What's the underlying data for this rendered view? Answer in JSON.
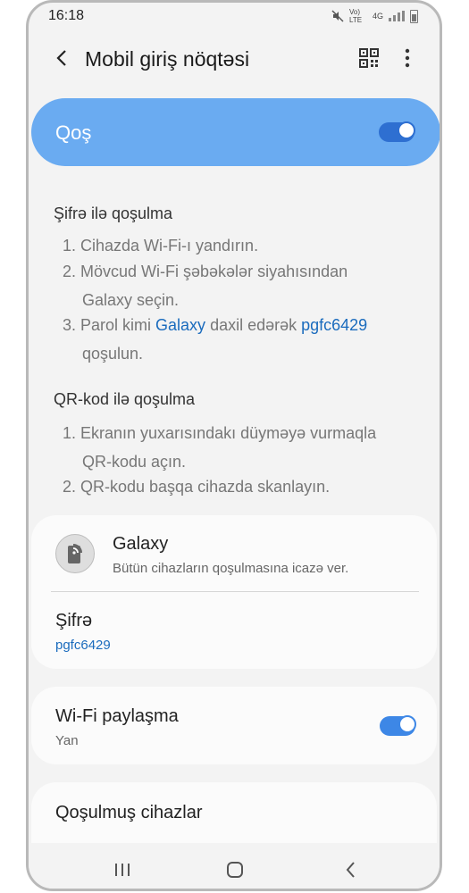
{
  "status": {
    "time": "16:18",
    "network_volte": "Vo) LTE",
    "network_4g": "4G"
  },
  "header": {
    "title": "Mobil giriş nöqtəsi",
    "back_icon": "back-arrow-icon",
    "qr_icon": "qr-code-icon",
    "more_icon": "more-vertical-icon"
  },
  "main_toggle": {
    "label": "Qoş",
    "on": true
  },
  "password_section": {
    "heading": "Şifrə ilə qoşulma",
    "step1": "1. Cihazda Wi-Fi-ı yandırın.",
    "step2_a": "2. Mövcud Wi-Fi şəbəkələr siyahısından",
    "step2_name": "Galaxy",
    "step2_b": " seçin.",
    "step3_a": "3. Parol kimi ",
    "step3_name": "Galaxy",
    "step3_b": " daxil edərək ",
    "step3_pass": "pgfc6429",
    "step3_c": "qoşulun."
  },
  "qr_section": {
    "heading": "QR-kod ilə qoşulma",
    "step1_a": "1. Ekranın yuxarısındakı düyməyə vurmaqla",
    "step1_b": "QR-kodu açın.",
    "step2": "2. QR-kodu başqa cihazda skanlayın."
  },
  "network": {
    "name": "Galaxy",
    "description": "Bütün cihazların qoşulmasına icazə ver.",
    "icon": "hotspot-icon"
  },
  "password": {
    "label": "Şifrə",
    "value": "pgfc6429"
  },
  "wifi_sharing": {
    "label": "Wi-Fi paylaşma",
    "status": "Yan",
    "on": true
  },
  "connected_devices": {
    "label": "Qoşulmuş cihazlar"
  },
  "nav": {
    "recents_icon": "recents-icon",
    "home_icon": "home-icon",
    "back_icon": "back-icon"
  },
  "colors": {
    "accent": "#6aabf1",
    "toggle": "#2e6fd1",
    "link": "#1a6bbd",
    "background": "#f3f3f3"
  }
}
